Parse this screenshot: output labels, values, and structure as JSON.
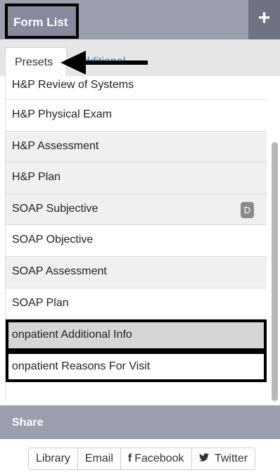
{
  "header": {
    "title": "Form List",
    "add_label": "+"
  },
  "tabs": {
    "presets": "Presets",
    "additional": "Additional"
  },
  "forms": [
    "H&P Review of Systems",
    "H&P Physical Exam",
    "H&P Assessment",
    "H&P Plan",
    "SOAP Subjective",
    "SOAP Objective",
    "SOAP Assessment",
    "SOAP Plan",
    "onpatient Additional Info",
    "onpatient Reasons For Visit"
  ],
  "badge": "D",
  "share": {
    "title": "Share",
    "buttons": {
      "library": "Library",
      "email": "Email",
      "facebook": "Facebook",
      "twitter": "Twitter"
    },
    "facebook_icon": "f",
    "twitter_icon": "🐦"
  },
  "icons": [
    "plus-icon",
    "arrow-left-icon",
    "facebook-icon",
    "twitter-icon"
  ]
}
